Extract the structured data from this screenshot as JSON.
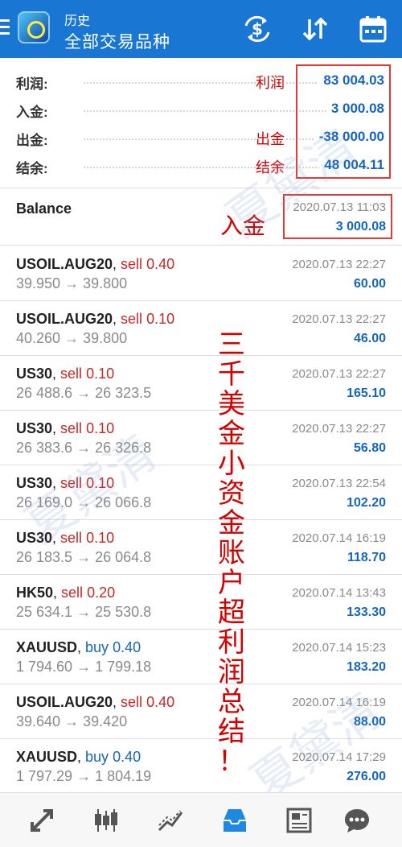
{
  "header": {
    "subtitle": "历史",
    "title": "全部交易品种",
    "icons": [
      "menu-icon",
      "app-logo",
      "currency-exchange-icon",
      "sort-icon",
      "calendar-icon"
    ]
  },
  "summary": {
    "rows": [
      {
        "label": "利润:",
        "value": "83 004.03",
        "annotation": "利润"
      },
      {
        "label": "入金:",
        "value": "3 000.08",
        "annotation": ""
      },
      {
        "label": "出金:",
        "value": "-38 000.00",
        "annotation": "出金"
      },
      {
        "label": "结余:",
        "value": "48 004.11",
        "annotation": "结余"
      }
    ]
  },
  "balance": {
    "label": "Balance",
    "time": "2020.07.13 11:03",
    "amount": "3 000.08",
    "annotation": "入金"
  },
  "deals": [
    {
      "symbol": "USOIL.AUG20",
      "type": "sell",
      "volume": "0.40",
      "prices": "39.950 → 39.800",
      "time": "2020.07.13 22:27",
      "profit": "60.00"
    },
    {
      "symbol": "USOIL.AUG20",
      "type": "sell",
      "volume": "0.10",
      "prices": "40.260 → 39.800",
      "time": "2020.07.13 22:27",
      "profit": "46.00"
    },
    {
      "symbol": "US30",
      "type": "sell",
      "volume": "0.10",
      "prices": "26 488.6 → 26 323.5",
      "time": "2020.07.13 22:27",
      "profit": "165.10"
    },
    {
      "symbol": "US30",
      "type": "sell",
      "volume": "0.10",
      "prices": "26 383.6 → 26 326.8",
      "time": "2020.07.13 22:27",
      "profit": "56.80"
    },
    {
      "symbol": "US30",
      "type": "sell",
      "volume": "0.10",
      "prices": "26 169.0 → 26 066.8",
      "time": "2020.07.13 22:54",
      "profit": "102.20"
    },
    {
      "symbol": "US30",
      "type": "sell",
      "volume": "0.10",
      "prices": "26 183.5 → 26 064.8",
      "time": "2020.07.14 16:19",
      "profit": "118.70"
    },
    {
      "symbol": "HK50",
      "type": "sell",
      "volume": "0.20",
      "prices": "25 634.1 → 25 530.8",
      "time": "2020.07.14 13:43",
      "profit": "133.30"
    },
    {
      "symbol": "XAUUSD",
      "type": "buy",
      "volume": "0.40",
      "prices": "1 794.60 → 1 799.18",
      "time": "2020.07.14 15:23",
      "profit": "183.20"
    },
    {
      "symbol": "USOIL.AUG20",
      "type": "sell",
      "volume": "0.40",
      "prices": "39.640 → 39.420",
      "time": "2020.07.14 16:19",
      "profit": "88.00"
    },
    {
      "symbol": "XAUUSD",
      "type": "buy",
      "volume": "0.40",
      "prices": "1 797.29 → 1 804.19",
      "time": "2020.07.14 17:29",
      "profit": "276.00"
    }
  ],
  "annotation_vertical": [
    "三",
    "千",
    "美",
    "金",
    "小",
    "资",
    "金",
    "账",
    "户",
    "超",
    "利",
    "润",
    "总",
    "结",
    "！"
  ],
  "watermark": [
    "夏黛清",
    "夏黛清",
    "夏黛清"
  ],
  "bottom_nav": [
    "quotes-icon",
    "chart-icon",
    "trade-icon",
    "history-icon",
    "news-icon",
    "chat-icon"
  ],
  "colors": {
    "header": "#1976d2",
    "sell": "#c62828",
    "buy": "#1565c0",
    "profit": "#1565c0",
    "annotation": "#d50000"
  }
}
